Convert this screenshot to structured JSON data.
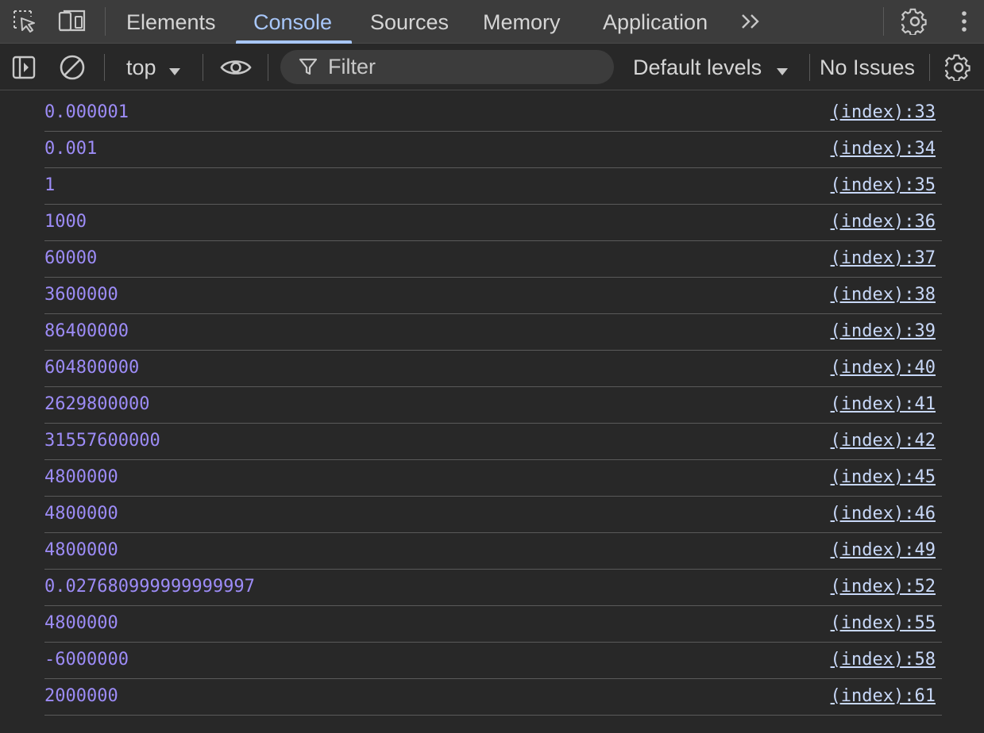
{
  "top_tabs": [
    {
      "label": "Elements"
    },
    {
      "label": "Console"
    },
    {
      "label": "Sources"
    },
    {
      "label": "Memory"
    },
    {
      "label": "Application"
    }
  ],
  "active_tab": "Console",
  "toolbar": {
    "context_label": "top",
    "filter_placeholder": "Filter",
    "levels_label": "Default levels",
    "issues_label": "No Issues"
  },
  "colors": {
    "background": "#282828",
    "value_text": "#9d8cf7",
    "link_text": "#c8d8f8",
    "active_tab": "#a8c7fa"
  },
  "console_rows": [
    {
      "value": "0.000001",
      "source": "(index):33"
    },
    {
      "value": "0.001",
      "source": "(index):34"
    },
    {
      "value": "1",
      "source": "(index):35"
    },
    {
      "value": "1000",
      "source": "(index):36"
    },
    {
      "value": "60000",
      "source": "(index):37"
    },
    {
      "value": "3600000",
      "source": "(index):38"
    },
    {
      "value": "86400000",
      "source": "(index):39"
    },
    {
      "value": "604800000",
      "source": "(index):40"
    },
    {
      "value": "2629800000",
      "source": "(index):41"
    },
    {
      "value": "31557600000",
      "source": "(index):42"
    },
    {
      "value": "4800000",
      "source": "(index):45"
    },
    {
      "value": "4800000",
      "source": "(index):46"
    },
    {
      "value": "4800000",
      "source": "(index):49"
    },
    {
      "value": "0.027680999999999997",
      "source": "(index):52"
    },
    {
      "value": "4800000",
      "source": "(index):55"
    },
    {
      "value": "-6000000",
      "source": "(index):58"
    },
    {
      "value": "2000000",
      "source": "(index):61"
    }
  ]
}
